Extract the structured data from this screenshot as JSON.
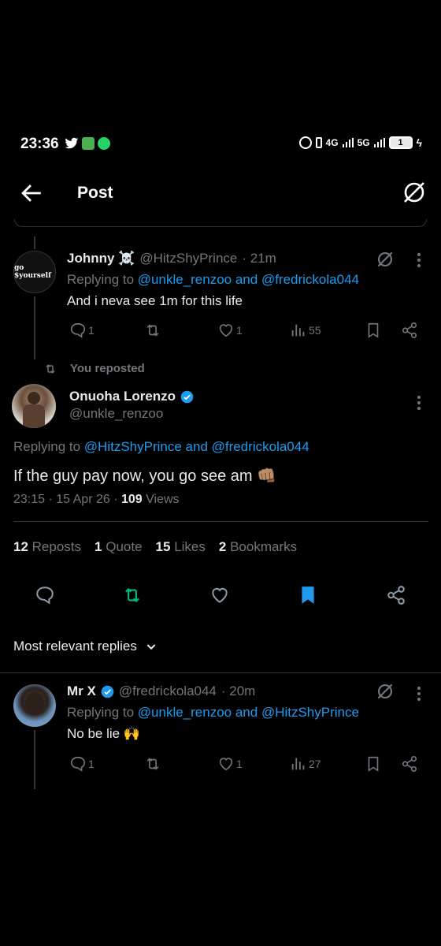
{
  "status_bar": {
    "time": "23:36",
    "battery": "1",
    "net1": "4G",
    "net2": "5G"
  },
  "header": {
    "title": "Post"
  },
  "reply1": {
    "name": "Johnny ☠️",
    "handle": "@HitzShyPrince",
    "time": "· 21m",
    "avatar_text": "go $yourself",
    "replying_label": "Replying to",
    "replying_users": "@unkle_renzoo and @fredrickola044",
    "text": "And i neva see 1m for this life",
    "replies": "1",
    "reposts": "",
    "likes": "1",
    "views": "55"
  },
  "main": {
    "repost_label": "You reposted",
    "name": "Onuoha Lorenzo",
    "handle": "@unkle_renzoo",
    "replying_label": "Replying to",
    "replying_users": "@HitzShyPrince and @fredrickola044",
    "text": "If the guy pay now, you go see am 👊🏽",
    "timestamp": "23:15 · 15 Apr 26 ·",
    "views_count": "109",
    "views_label": "Views",
    "stats": {
      "reposts_count": "12",
      "reposts_label": "Reposts",
      "quote_count": "1",
      "quote_label": "Quote",
      "likes_count": "15",
      "likes_label": "Likes",
      "bookmarks_count": "2",
      "bookmarks_label": "Bookmarks"
    },
    "colors": {
      "repost_active": "#00ba7c",
      "bookmark_active": "#1d9bf0"
    }
  },
  "sort": {
    "label": "Most relevant replies"
  },
  "reply2": {
    "name": "Mr X",
    "handle": "@fredrickola044",
    "time": "· 20m",
    "replying_label": "Replying to",
    "replying_users": "@unkle_renzoo and @HitzShyPrince",
    "text": "No be lie 🙌",
    "replies": "1",
    "reposts": "",
    "likes": "1",
    "views": "27"
  }
}
